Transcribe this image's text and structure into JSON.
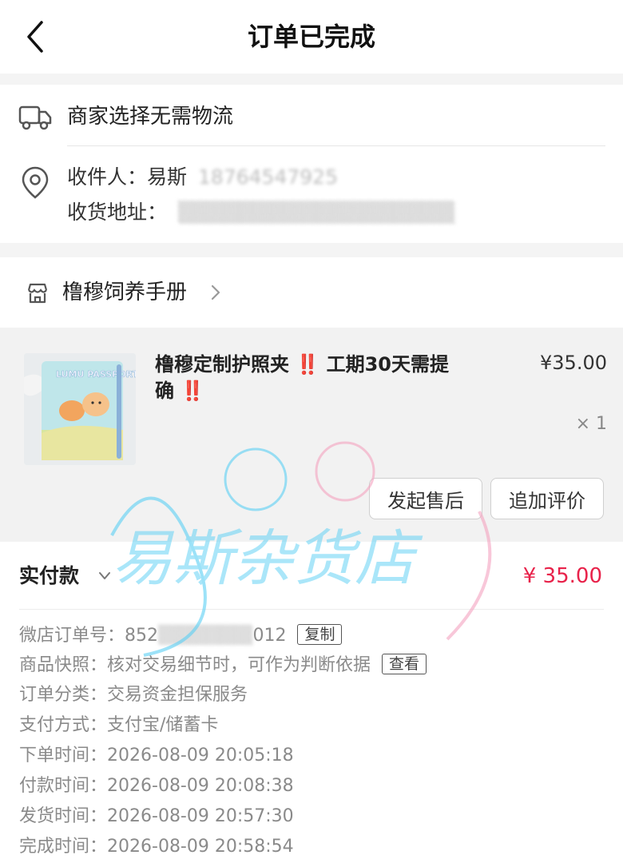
{
  "header": {
    "title": "订单已完成"
  },
  "logistics": {
    "text": "商家选择无需物流"
  },
  "recipient": {
    "label": "收件人：",
    "name": "易斯",
    "phone": "18764547925",
    "address_label": "收货地址："
  },
  "shop": {
    "name": "橹穆饲养手册"
  },
  "product": {
    "title": "橹穆定制护照夹",
    "title_mid": "工期30天需提确",
    "bang": "‼️",
    "price": "¥35.00",
    "qty": "× 1",
    "thumb_label": "LUMU PASSPORT",
    "after_sale_btn": "发起售后",
    "review_btn": "追加评价"
  },
  "payment": {
    "label": "实付款",
    "amount": "¥ 35.00"
  },
  "order_info": {
    "order_no_label": "微店订单号：",
    "order_no_visible": "852",
    "order_no_tail": "012",
    "copy_btn": "复制",
    "snapshot_label": "商品快照：",
    "snapshot_value": "核对交易细节时，可作为判断依据",
    "view_btn": "查看",
    "category_label": "订单分类：",
    "category_value": "交易资金担保服务",
    "pay_method_label": "支付方式：",
    "pay_method_value": "支付宝/储蓄卡",
    "order_time_label": "下单时间：",
    "order_time_value": "2026-08-09 20:05:18",
    "pay_time_label": "付款时间：",
    "pay_time_value": "2026-08-09 20:08:38",
    "ship_time_label": "发货时间：",
    "ship_time_value": "2026-08-09 20:57:30",
    "done_time_label": "完成时间：",
    "done_time_value": "2026-08-09 20:58:54"
  },
  "watermark": {
    "text": "易斯杂货店"
  },
  "colors": {
    "accent_red": "#e8224a",
    "bang_red": "#e02020",
    "watermark_blue": "#5bd0f5",
    "watermark_pink": "#f5a3c0"
  }
}
